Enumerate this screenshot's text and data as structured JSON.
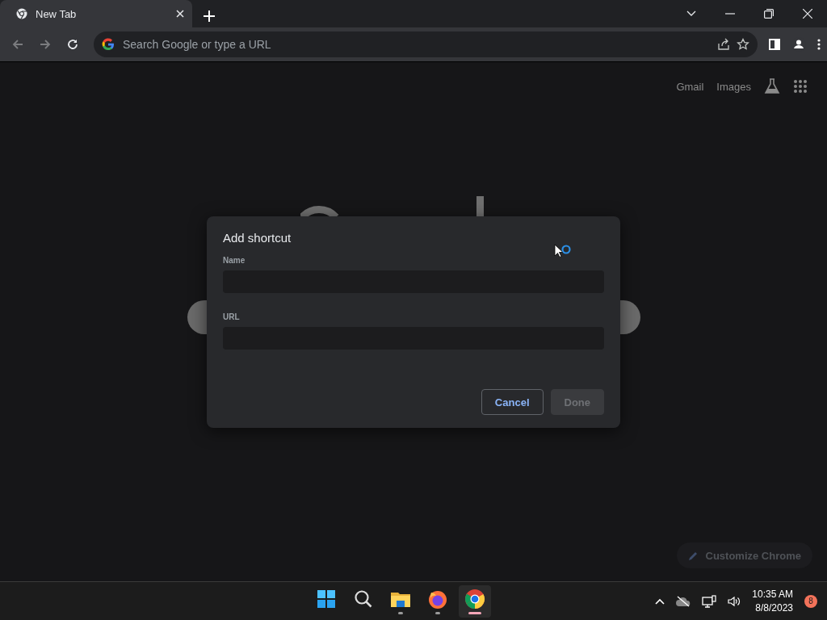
{
  "browser": {
    "tabs": [
      {
        "title": "New Tab",
        "selected": true
      }
    ],
    "omnibox": {
      "placeholder": "Search Google or type a URL"
    },
    "nav": [
      {
        "kind": "back",
        "disabled": true
      },
      {
        "kind": "forward",
        "disabled": true
      },
      {
        "kind": "reload",
        "disabled": false
      }
    ]
  },
  "page": {
    "links": [
      "Gmail",
      "Images"
    ],
    "customize_button": "Customize Chrome"
  },
  "dialog": {
    "title": "Add shortcut",
    "fields": [
      {
        "label": "Name"
      },
      {
        "label": "URL"
      }
    ],
    "buttons": [
      {
        "label": "Cancel",
        "disabled": false
      },
      {
        "label": "Done",
        "disabled": true
      }
    ]
  },
  "taskbar": {
    "apps": [
      {
        "kind": "start",
        "running": false,
        "active": false
      },
      {
        "kind": "search",
        "running": false,
        "active": false
      },
      {
        "kind": "files",
        "running": true,
        "active": false
      },
      {
        "kind": "firefox",
        "running": true,
        "active": false
      },
      {
        "kind": "chrome",
        "running": true,
        "active": true
      }
    ],
    "time": "10:35 AM",
    "date": "8/8/2023",
    "notifications": "8"
  }
}
